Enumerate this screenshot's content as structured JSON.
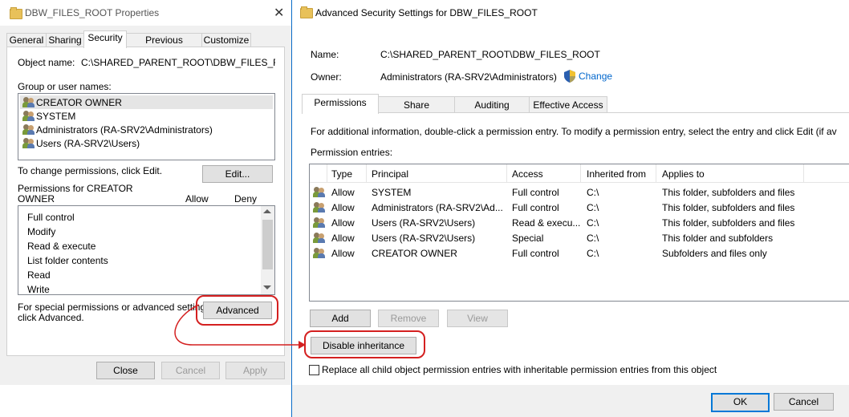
{
  "left_dialog": {
    "title": "DBW_FILES_ROOT Properties",
    "close_glyph": "✕",
    "tabs": [
      "General",
      "Sharing",
      "Security",
      "Previous Versions",
      "Customize"
    ],
    "active_tab": "Security",
    "object_name_label": "Object name:",
    "object_name_value": "C:\\SHARED_PARENT_ROOT\\DBW_FILES_ROOC",
    "group_label": "Group or user names:",
    "groups": [
      "CREATOR OWNER",
      "SYSTEM",
      "Administrators (RA-SRV2\\Administrators)",
      "Users (RA-SRV2\\Users)"
    ],
    "change_hint": "To change permissions, click Edit.",
    "edit_button": "Edit...",
    "permissions_for_line1": "Permissions for CREATOR",
    "permissions_for_line2": "OWNER",
    "allow_header": "Allow",
    "deny_header": "Deny",
    "permissions": [
      "Full control",
      "Modify",
      "Read & execute",
      "List folder contents",
      "Read",
      "Write"
    ],
    "special_hint_line1": "For special permissions or advanced settings,",
    "special_hint_line2": "click Advanced.",
    "advanced_button": "Advanced",
    "close_button": "Close",
    "cancel_button": "Cancel",
    "apply_button": "Apply"
  },
  "right_dialog": {
    "title": "Advanced Security Settings for DBW_FILES_ROOT",
    "name_label": "Name:",
    "name_value": "C:\\SHARED_PARENT_ROOT\\DBW_FILES_ROOT",
    "owner_label": "Owner:",
    "owner_value": "Administrators (RA-SRV2\\Administrators)",
    "change_link": "Change",
    "tabs": [
      "Permissions",
      "Share",
      "Auditing",
      "Effective Access"
    ],
    "active_tab": "Permissions",
    "info_text": "For additional information, double-click a permission entry. To modify a permission entry, select the entry and click Edit (if av",
    "entries_label": "Permission entries:",
    "columns": [
      "Type",
      "Principal",
      "Access",
      "Inherited from",
      "Applies to"
    ],
    "rows": [
      {
        "type": "Allow",
        "principal": "SYSTEM",
        "access": "Full control",
        "inherited": "C:\\",
        "applies": "This folder, subfolders and files"
      },
      {
        "type": "Allow",
        "principal": "Administrators (RA-SRV2\\Ad...",
        "access": "Full control",
        "inherited": "C:\\",
        "applies": "This folder, subfolders and files"
      },
      {
        "type": "Allow",
        "principal": "Users (RA-SRV2\\Users)",
        "access": "Read & execu...",
        "inherited": "C:\\",
        "applies": "This folder, subfolders and files"
      },
      {
        "type": "Allow",
        "principal": "Users (RA-SRV2\\Users)",
        "access": "Special",
        "inherited": "C:\\",
        "applies": "This folder and subfolders"
      },
      {
        "type": "Allow",
        "principal": "CREATOR OWNER",
        "access": "Full control",
        "inherited": "C:\\",
        "applies": "Subfolders and files only"
      }
    ],
    "add_button": "Add",
    "remove_button": "Remove",
    "view_button": "View",
    "disable_inheritance_button": "Disable inheritance",
    "replace_checkbox_label": "Replace all child object permission entries with inheritable permission entries from this object",
    "ok_button": "OK",
    "cancel_button": "Cancel"
  },
  "colors": {
    "annotation_red": "#d42020",
    "link_blue": "#0066cc",
    "accent_border": "#0a6cc8"
  }
}
